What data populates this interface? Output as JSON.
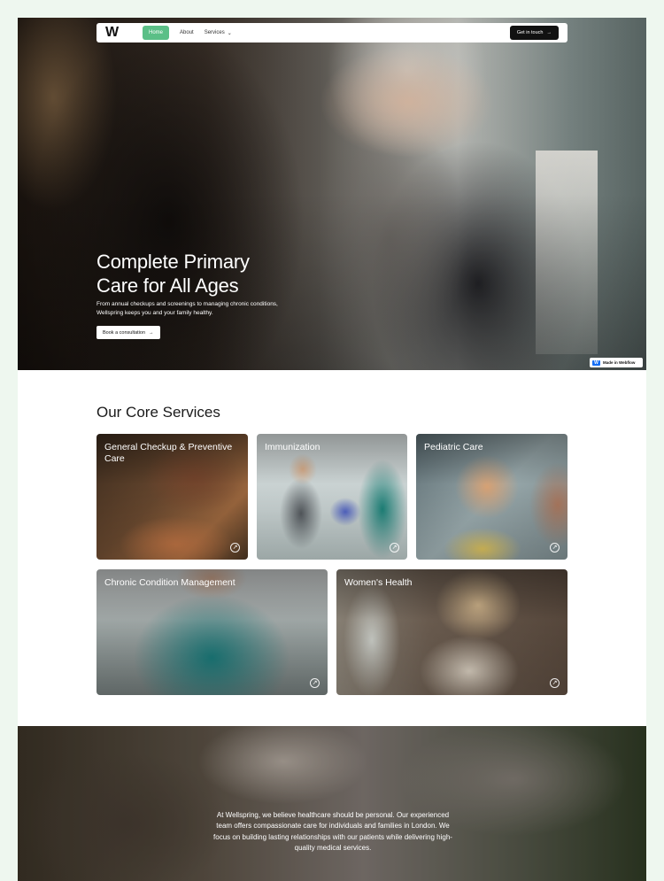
{
  "nav": {
    "logo": "W",
    "home": "Home",
    "about": "About",
    "services": "Services",
    "cta": "Get in touch"
  },
  "hero": {
    "title_line1": "Complete Primary",
    "title_line2": "Care for All Ages",
    "subtitle_line1": "From annual checkups and screenings to managing chronic conditions,",
    "subtitle_line2": "Wellspring keeps you and your family healthy.",
    "button": "Book a consultation"
  },
  "badge": {
    "label": "Made in Webflow"
  },
  "services": {
    "title": "Our Core Services",
    "cards": [
      {
        "label": "General Checkup & Preventive Care"
      },
      {
        "label": "Immunization"
      },
      {
        "label": "Pediatric Care"
      },
      {
        "label": "Chronic Condition Management"
      },
      {
        "label": "Women's Health"
      }
    ]
  },
  "about": {
    "text": "At Wellspring, we believe healthcare should be personal. Our experienced team offers compassionate care for individuals and families in London. We focus on building lasting relationships with our patients while delivering high-quality medical services."
  },
  "icons": {
    "arrow": "arrow-right-icon",
    "chevron": "chevron-down-icon",
    "card_arrow": "arrow-up-right-circle-icon",
    "webflow": "webflow-logo-icon"
  },
  "colors": {
    "page_bg": "#eef7ef",
    "accent": "#5bbf87",
    "cta": "#111111"
  }
}
